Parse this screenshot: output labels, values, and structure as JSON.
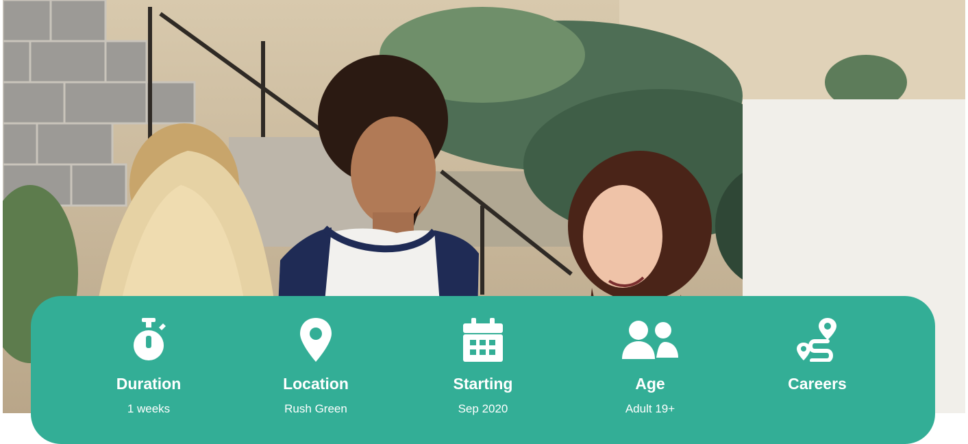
{
  "hero": {
    "image": "photo-students-talking-outdoors"
  },
  "colors": {
    "accent": "#33ae96",
    "text_on_accent": "#ffffff"
  },
  "info": [
    {
      "icon": "stopwatch-icon",
      "title": "Duration",
      "value": "1 weeks"
    },
    {
      "icon": "map-pin-icon",
      "title": "Location",
      "value": "Rush Green"
    },
    {
      "icon": "calendar-icon",
      "title": "Starting",
      "value": "Sep 2020"
    },
    {
      "icon": "users-icon",
      "title": "Age",
      "value": "Adult 19+"
    },
    {
      "icon": "route-icon",
      "title": "Careers",
      "value": ""
    }
  ]
}
